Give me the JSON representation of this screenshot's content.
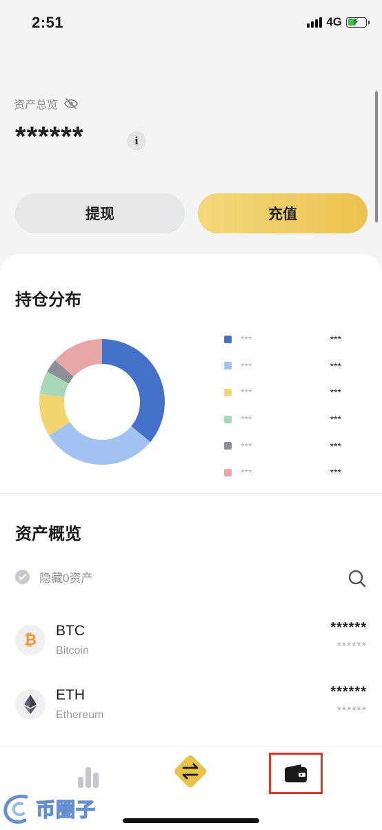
{
  "status_bar": {
    "time": "2:51",
    "network": "4G"
  },
  "header": {
    "overview_label": "资产总览",
    "total_masked": "******",
    "info_icon": "i",
    "withdraw_label": "提现",
    "deposit_label": "充值"
  },
  "holdings": {
    "title": "持仓分布",
    "legend": [
      {
        "name": "***",
        "value": "***",
        "color": "#4472ca"
      },
      {
        "name": "***",
        "value": "***",
        "color": "#a2c2f1"
      },
      {
        "name": "***",
        "value": "***",
        "color": "#f2d56d"
      },
      {
        "name": "***",
        "value": "***",
        "color": "#a8d8b8"
      },
      {
        "name": "***",
        "value": "***",
        "color": "#8c8f97"
      },
      {
        "name": "***",
        "value": "***",
        "color": "#e8a6a8"
      }
    ]
  },
  "chart_data": {
    "type": "pie",
    "title": "持仓分布",
    "series": [
      {
        "color": "#4472ca",
        "value": 0.36
      },
      {
        "color": "#a2c2f1",
        "value": 0.3
      },
      {
        "color": "#f2d56d",
        "value": 0.11
      },
      {
        "color": "#a8d8b8",
        "value": 0.06
      },
      {
        "color": "#8c8f97",
        "value": 0.035
      },
      {
        "color": "#e8a6a8",
        "value": 0.135
      }
    ]
  },
  "assets": {
    "title": "资产概览",
    "hide_zero_label": "隐藏0资产",
    "items": [
      {
        "symbol": "BTC",
        "name": "Bitcoin",
        "amount": "******",
        "value": "******"
      },
      {
        "symbol": "ETH",
        "name": "Ethereum",
        "amount": "******",
        "value": "******"
      }
    ]
  },
  "tabbar": {
    "items": [
      {
        "icon": "bar-chart-icon"
      },
      {
        "icon": "swap-icon"
      },
      {
        "icon": "wallet-icon"
      }
    ]
  },
  "watermark": {
    "text": "币圈子"
  }
}
